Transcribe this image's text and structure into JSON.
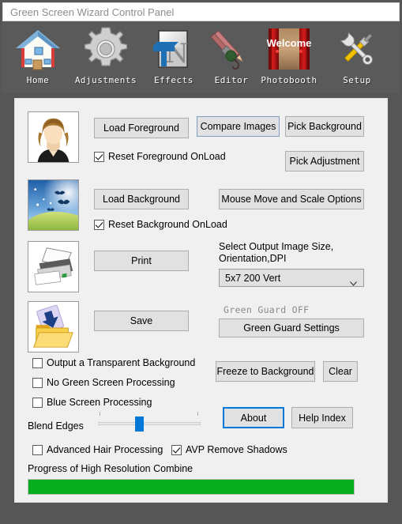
{
  "window": {
    "title": "Green Screen Wizard Control Panel"
  },
  "toolbar": {
    "items": [
      {
        "label": "Home",
        "icon": "home-icon"
      },
      {
        "label": "Adjustments",
        "icon": "gear-icon"
      },
      {
        "label": "Effects",
        "icon": "text-effects-icon"
      },
      {
        "label": "Editor",
        "icon": "brush-pencil-icon"
      },
      {
        "label": "Photobooth",
        "icon": "welcome-curtain-icon"
      },
      {
        "label": "Setup",
        "icon": "wrench-screwdriver-icon"
      }
    ],
    "photobooth_caption": "Welcome"
  },
  "main": {
    "buttons": {
      "load_foreground": "Load Foreground",
      "load_background": "Load Background",
      "compare_images": "Compare Images",
      "pick_background": "Pick Background",
      "pick_adjustment": "Pick Adjustment",
      "mouse_move_scale": "Mouse Move and Scale Options",
      "print": "Print",
      "save": "Save",
      "green_guard_settings": "Green Guard Settings",
      "freeze_to_background": "Freeze to Background",
      "clear": "Clear",
      "about": "About",
      "help_index": "Help Index"
    },
    "checkboxes": {
      "reset_foreground_onload": {
        "label": "Reset Foreground OnLoad",
        "checked": true
      },
      "reset_background_onload": {
        "label": "Reset Background OnLoad",
        "checked": true
      },
      "output_transparent_background": {
        "label": "Output a Transparent Background",
        "checked": false
      },
      "no_green_screen_processing": {
        "label": "No Green Screen Processing",
        "checked": false
      },
      "blue_screen_processing": {
        "label": "Blue Screen Processing",
        "checked": false
      },
      "advanced_hair_processing": {
        "label": "Advanced Hair Processing",
        "checked": false
      },
      "avp_remove_shadows": {
        "label": "AVP Remove Shadows",
        "checked": true
      }
    },
    "output_size": {
      "label_line1": "Select Output Image Size,",
      "label_line2": "Orientation,DPI",
      "selected": "5x7 200 Vert",
      "options": [
        "5x7 200 Vert"
      ]
    },
    "green_guard_status": "Green Guard OFF",
    "blend_edges": {
      "label": "Blend Edges",
      "value_percent": 40
    },
    "progress": {
      "label": "Progress of High Resolution Combine",
      "value_percent": 100
    },
    "thumbnails": {
      "foreground": "woman-portrait-thumbnail",
      "background": "sky-landscape-birds-thumbnail",
      "print": "printer-scanner-icon",
      "save": "save-folder-icon"
    }
  },
  "colors": {
    "toolbar_bg": "#5a5a5a",
    "panel_bg": "#f0f0f0",
    "accent": "#0078d7",
    "progress_green": "#06ad1f",
    "title_text": "#8d8d8d"
  }
}
